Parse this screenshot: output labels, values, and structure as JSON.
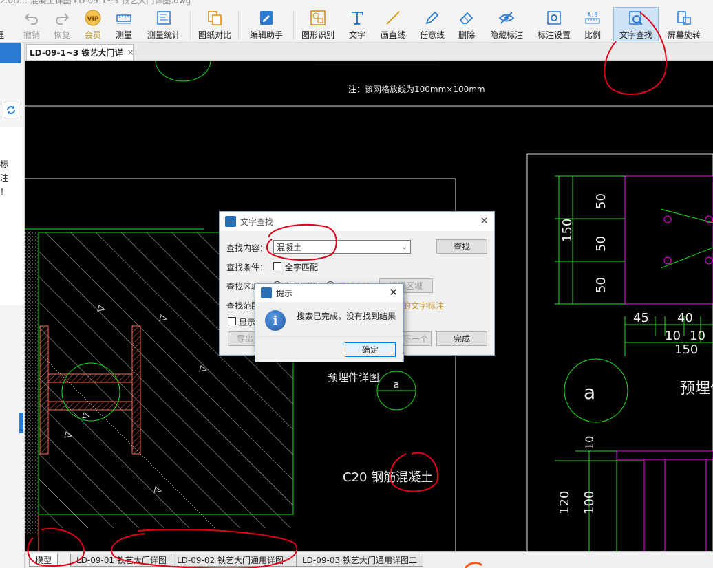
{
  "window": {
    "title": "2.0D...  混凝土详图  LD-09-1~3 铁艺大门详图.dwg"
  },
  "toolbar": {
    "items": [
      {
        "label": "撤销",
        "icon": "undo-icon"
      },
      {
        "label": "恢复",
        "icon": "redo-icon"
      },
      {
        "label": "会员",
        "icon": "vip-icon"
      },
      {
        "label": "测量",
        "icon": "ruler-icon"
      },
      {
        "label": "测量统计",
        "icon": "measure-stats-icon"
      },
      {
        "label": "图纸对比",
        "icon": "compare-icon"
      },
      {
        "label": "编辑助手",
        "icon": "edit-assistant-icon"
      },
      {
        "label": "图形识别",
        "icon": "shape-recognition-icon"
      },
      {
        "label": "文字",
        "icon": "text-icon"
      },
      {
        "label": "画直线",
        "icon": "line-icon"
      },
      {
        "label": "任意线",
        "icon": "pen-icon"
      },
      {
        "label": "删除",
        "icon": "eraser-icon"
      },
      {
        "label": "隐藏标注",
        "icon": "eye-hide-icon"
      },
      {
        "label": "标注设置",
        "icon": "annotation-settings-icon"
      },
      {
        "label": "比例",
        "icon": "scale-icon"
      },
      {
        "label": "文字查找",
        "icon": "text-search-icon"
      },
      {
        "label": "屏幕旋转",
        "icon": "rotate-icon"
      }
    ],
    "left_cut_label": "理",
    "vip_badge": "VIP"
  },
  "left_panel": {
    "fragments": [
      "标",
      "注",
      "！"
    ]
  },
  "doc_tab": {
    "label": "LD-09-1~3 铁艺大门详",
    "close": "×"
  },
  "drawing": {
    "note": "注：该网格放线为100mm×100mm",
    "detail_label_left": "预埋件详图",
    "detail_label_right": "预埋件",
    "concrete_label": "C20 钢筋混凝土",
    "circle_letter": "a",
    "dims_vertical": [
      "150",
      "50",
      "50",
      "50"
    ],
    "dims_horizontal_top": [
      "45",
      "40"
    ],
    "dims_horizontal_bottom": [
      "10",
      "10",
      "150"
    ],
    "dims_bottom": [
      "120",
      "100",
      "10"
    ]
  },
  "layout_tabs": [
    {
      "label": "模型",
      "selected": true
    },
    {
      "label": "LD-09-01 铁艺大门详图",
      "selected": false
    },
    {
      "label": "LD-09-02 铁艺大门通用详图一",
      "selected": false
    },
    {
      "label": "LD-09-03 铁艺大门通用详图二",
      "selected": false
    }
  ],
  "find_dialog": {
    "title": "文字查找",
    "content_label": "查找内容：",
    "content_value": "混凝土",
    "find_button": "查找",
    "condition_label": "查找条件：",
    "full_match": "全字匹配",
    "area_label": "查找区域：",
    "area_option1": "整张图纸",
    "area_option2": "区域查找",
    "select_area_button": "选择区域",
    "range_label": "查找范围：",
    "range_hint": "的文字标注",
    "show_label": "显示",
    "export_button": "导出",
    "next_button": "下一个",
    "done_button": "完成"
  },
  "message_box": {
    "title": "提示",
    "message": "搜索已完成，没有找到结果",
    "ok_button": "确定"
  },
  "colors": {
    "annotation": "#e0001a",
    "cad_green": "#19e619",
    "cad_magenta": "#ff00ff",
    "hatch_red": "#ff6a4d"
  }
}
